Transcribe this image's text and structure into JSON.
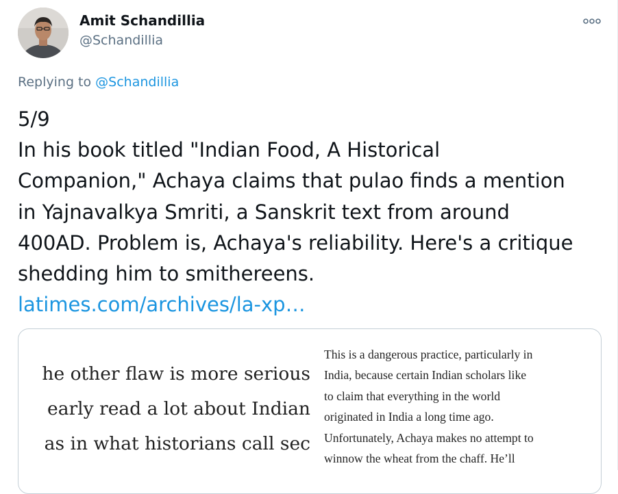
{
  "tweet": {
    "author": {
      "name": "Amit Schandillia",
      "handle": "@Schandillia"
    },
    "replying_prefix": "Replying to ",
    "replying_to": "@Schandillia",
    "text_lines": [
      "5/9",
      "In his book titled \"Indian Food, A Historical",
      "Companion,\" Achaya claims that pulao finds a mention",
      "in Yajnavalkya Smriti, a Sanskrit text from around",
      "400AD. Problem is, Achaya's reliability. Here's a critique",
      "shedding him to smithereens."
    ],
    "link_text": "latimes.com/archives/la-xp…",
    "media": {
      "left_lines": [
        "he other flaw is more serious",
        "early read a lot about Indian",
        "as in what historians call sec"
      ],
      "right_lines": [
        "This is a dangerous practice, particularly in",
        "India, because certain Indian scholars like",
        "to claim that everything in the world",
        "originated in India a long time ago.",
        "Unfortunately, Achaya makes no attempt to",
        "winnow the wheat from the chaff. He’ll"
      ]
    }
  },
  "icons": {
    "avatar": "profile-photo",
    "more": "more-horizontal-icon"
  },
  "colors": {
    "text": "#0f1419",
    "secondary": "#5b7083",
    "link": "#1b95e0",
    "border": "#c4cfd6"
  }
}
